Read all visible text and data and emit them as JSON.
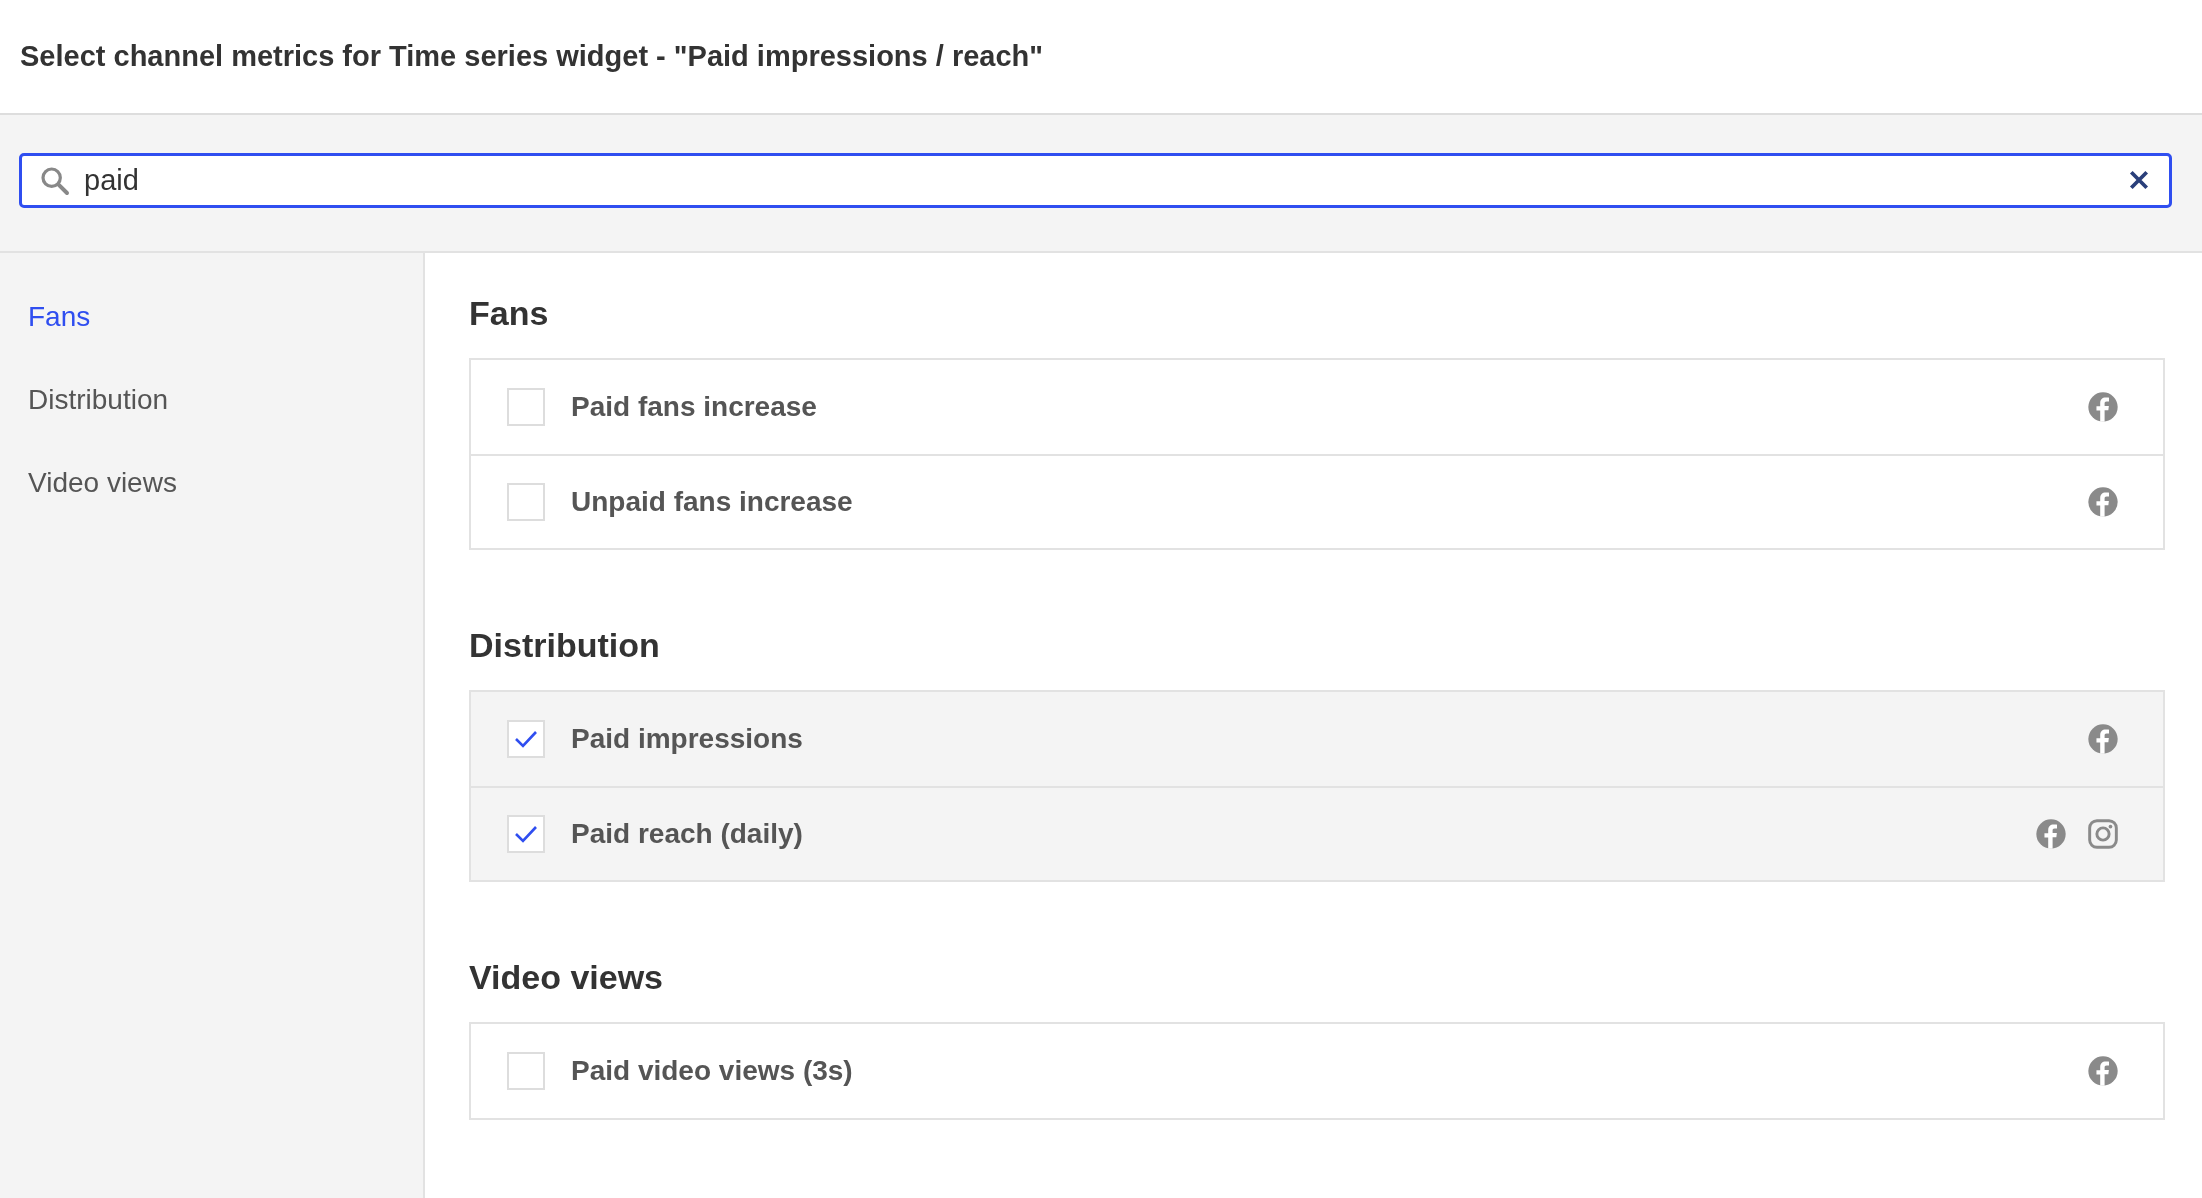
{
  "title": "Select channel metrics for Time series widget - \"Paid impressions / reach\"",
  "search": {
    "value": "paid"
  },
  "sidebar": {
    "items": [
      {
        "label": "Fans",
        "selected": true
      },
      {
        "label": "Distribution",
        "selected": false
      },
      {
        "label": "Video views",
        "selected": false
      }
    ]
  },
  "sections": [
    {
      "heading": "Fans",
      "metrics": [
        {
          "label": "Paid fans increase",
          "checked": false,
          "channels": [
            {
              "kind": "facebook"
            }
          ]
        },
        {
          "label": "Unpaid fans increase",
          "checked": false,
          "channels": [
            {
              "kind": "facebook"
            }
          ]
        }
      ]
    },
    {
      "heading": "Distribution",
      "metrics": [
        {
          "label": "Paid impressions",
          "checked": true,
          "channels": [
            {
              "kind": "facebook"
            }
          ]
        },
        {
          "label": "Paid reach (daily)",
          "checked": true,
          "channels": [
            {
              "kind": "facebook"
            },
            {
              "kind": "instagram"
            }
          ]
        }
      ]
    },
    {
      "heading": "Video views",
      "metrics": [
        {
          "label": "Paid video views (3s)",
          "checked": false,
          "channels": [
            {
              "kind": "facebook"
            }
          ]
        }
      ]
    }
  ]
}
